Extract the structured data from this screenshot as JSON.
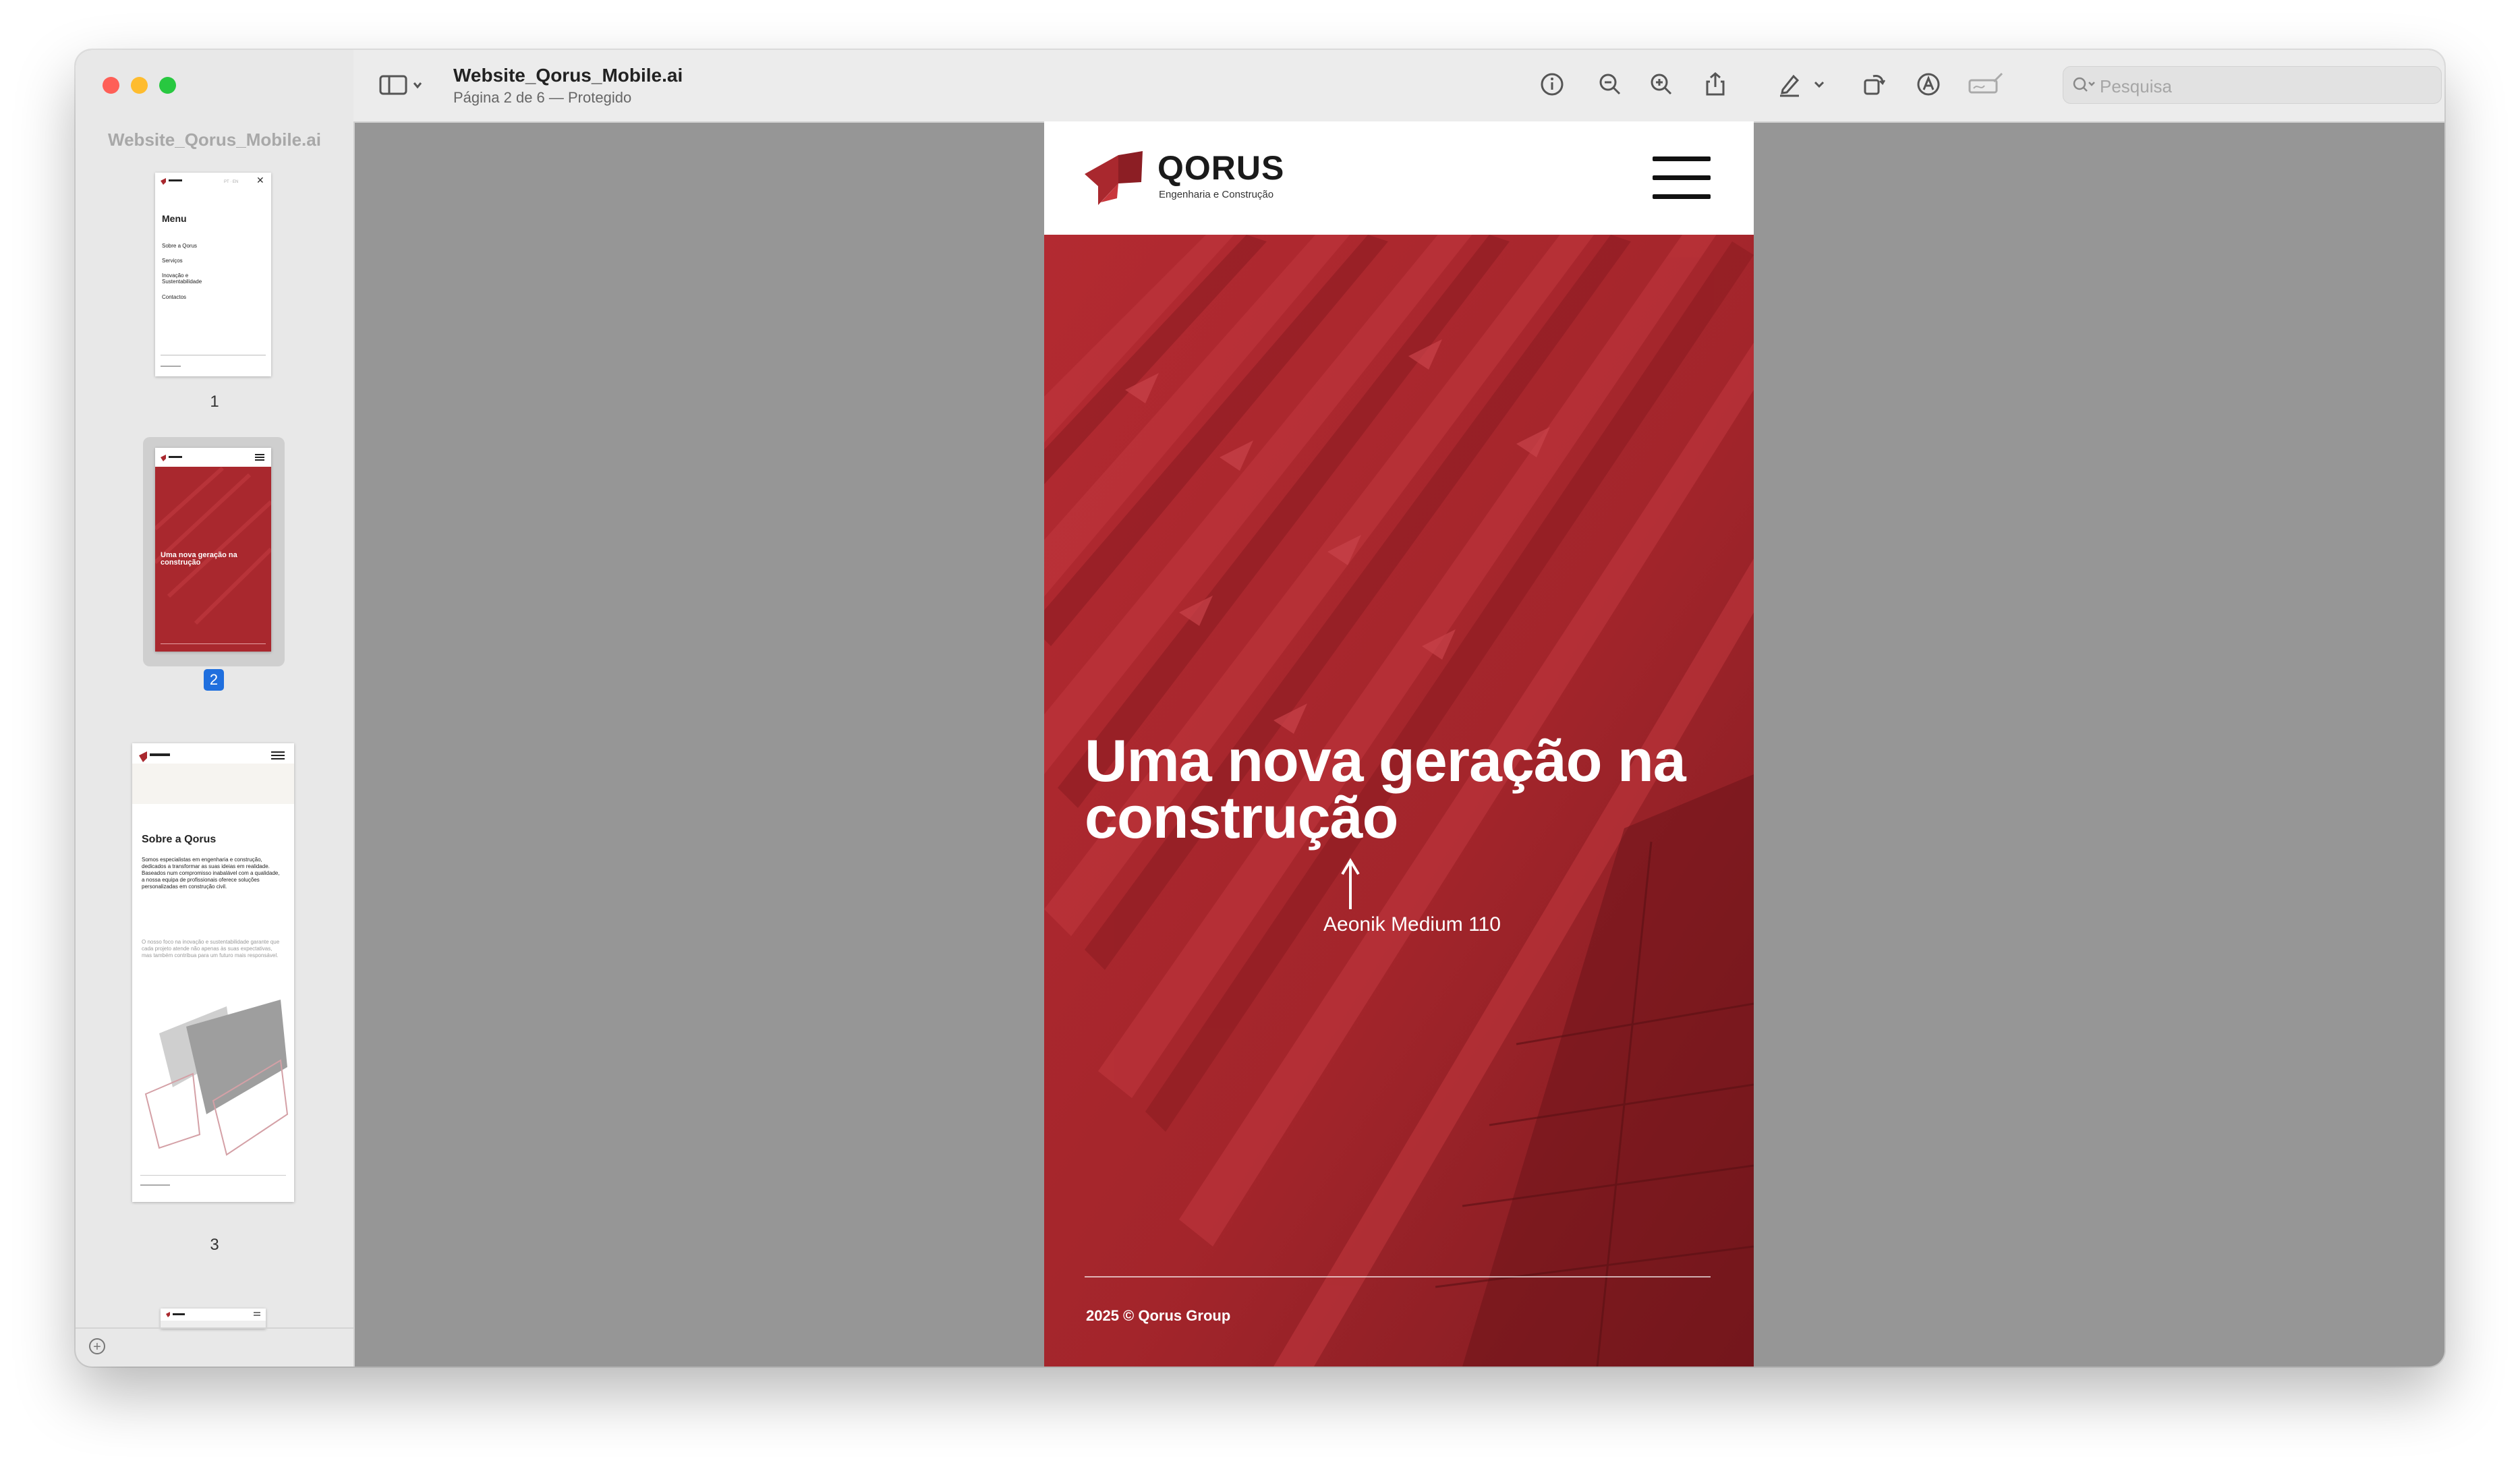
{
  "app": {
    "document_title": "Website_Qorus_Mobile.ai",
    "subtitle": "Página 2 de 6 — Protegido",
    "search_placeholder": "Pesquisa"
  },
  "sidebar": {
    "title": "Website_Qorus_Mobile.ai",
    "thumbnails": [
      {
        "label": "1",
        "menu_heading": "Menu",
        "menu_items": [
          "Sobre a Qorus",
          "Serviços",
          "Inovação e Sustentabilidade",
          "Contactos"
        ]
      },
      {
        "label": "2",
        "headline": "Uma nova geração na construção"
      },
      {
        "label": "3",
        "heading": "Sobre a Qorus",
        "body": "Somos especialistas em engenharia e construção, dedicados a transformar as suas ideias em realidade. Baseados num compromisso inabalável com a qualidade, a nossa equipa de profissionais oferece soluções personalizadas em construção civil.",
        "body2": "O nosso foco na inovação e sustentabilidade garante que cada projeto atende não apenas às suas expectativas, mas também contribua para um futuro mais responsável."
      }
    ]
  },
  "page": {
    "brand": "QORUS",
    "brand_tagline": "Engenharia e Construção",
    "headline": "Uma nova geração na construção",
    "annotation": "Aeonik Medium 110",
    "footer": "2025 © Qorus Group"
  },
  "icons": {
    "sidebar_toggle": "sidebar-icon",
    "info": "info-icon",
    "zoom_out": "zoom-out-icon",
    "zoom_in": "zoom-in-icon",
    "share": "share-icon",
    "markup": "pen-icon",
    "rotate": "rotate-icon",
    "annotate": "annotate-icon",
    "sign": "signature-icon",
    "search": "search-icon"
  },
  "colors": {
    "brand_red": "#a9282e",
    "selection_blue": "#1f6fde"
  }
}
